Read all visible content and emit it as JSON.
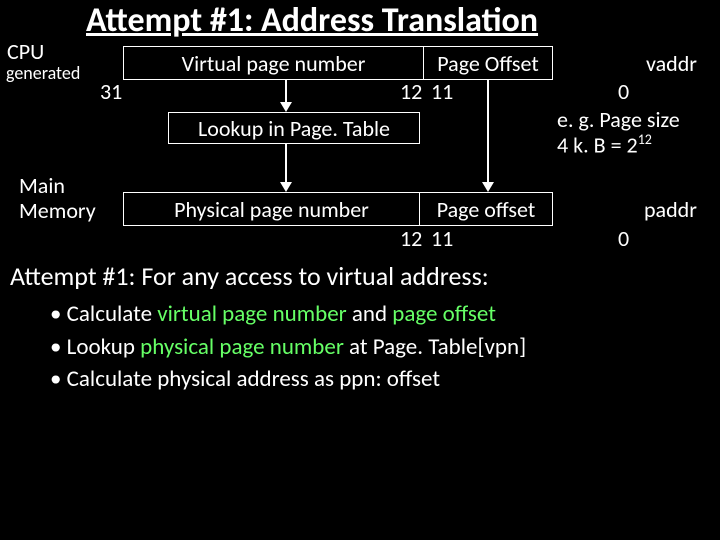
{
  "title": "Attempt #1: Address Translation",
  "cpu": {
    "line1": "CPU",
    "line2": "generated"
  },
  "mainmem": {
    "line1": "Main",
    "line2": "Memory"
  },
  "vaddr": {
    "vpn": "Virtual page number",
    "offset": "Page Offset",
    "hi": "31",
    "mid_r": "12",
    "mid_l": "11",
    "lo": "0",
    "rlabel": "vaddr"
  },
  "lookup": "Lookup in Page. Table",
  "note": {
    "l1": "e. g. Page size",
    "l2_a": "4 k. B = 2",
    "l2_sup": "12"
  },
  "paddr": {
    "ppn": "Physical page number",
    "offset": "Page offset",
    "mid_r": "12",
    "mid_l": "11",
    "lo": "0",
    "rlabel": "paddr"
  },
  "subtitle": "Attempt #1: For any access to virtual address:",
  "bullets": {
    "b1a": "Calculate ",
    "b1b": "virtual page number ",
    "b1c": "and ",
    "b1d": "page offset",
    "b2a": "Lookup ",
    "b2b": "physical page number ",
    "b2c": "at Page. Table[vpn]",
    "b3": "Calculate physical address as ppn: offset"
  }
}
